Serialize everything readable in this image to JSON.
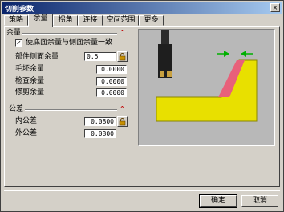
{
  "window": {
    "title": "切削参数",
    "close_label": "×"
  },
  "tabs": [
    {
      "label": "策略"
    },
    {
      "label": "余量"
    },
    {
      "label": "拐角"
    },
    {
      "label": "连接"
    },
    {
      "label": "空间范围"
    },
    {
      "label": "更多"
    }
  ],
  "allowance_group": {
    "title": "余量",
    "same_floor_side_label": "使底面余量与侧面余量一致",
    "same_floor_side_checked": true,
    "check_mark": "✓",
    "fields": [
      {
        "label": "部件侧面余量",
        "value": "0.5"
      },
      {
        "label": "毛坯余量",
        "value": "0.0000"
      },
      {
        "label": "检查余量",
        "value": "0.0000"
      },
      {
        "label": "修剪余量",
        "value": "0.0000"
      }
    ]
  },
  "tolerance_group": {
    "title": "公差",
    "fields": [
      {
        "label": "内公差",
        "value": "0.0800"
      },
      {
        "label": "外公差",
        "value": "0.0800"
      }
    ]
  },
  "chevron_glyph": "⌃",
  "buttons": {
    "ok": "确定",
    "cancel": "取消"
  },
  "colors": {
    "part": "#e8e000",
    "allowance": "#e8607a",
    "arrows": "#00b000",
    "tool_body": "#2a2a2a",
    "tool_insert": "#c8a040"
  }
}
